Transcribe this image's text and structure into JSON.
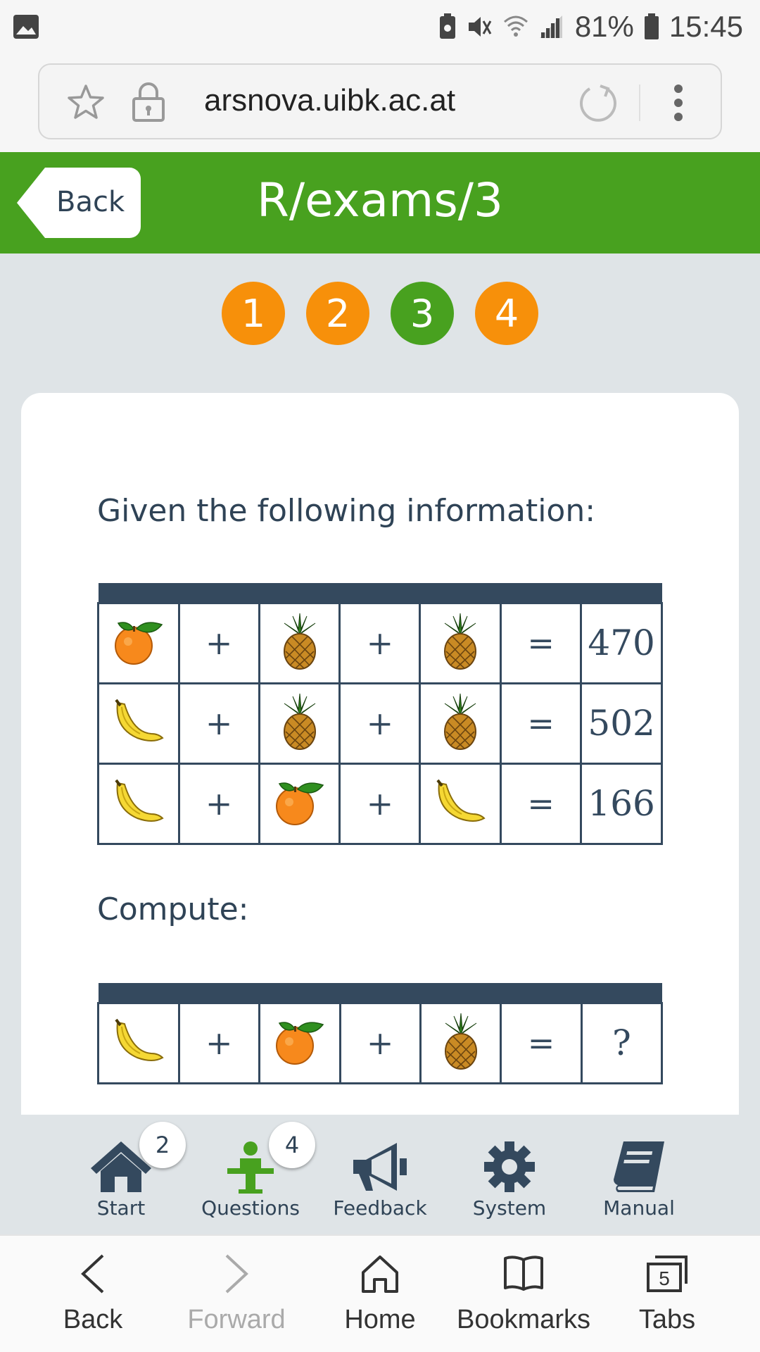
{
  "status_bar": {
    "battery_percent": "81%",
    "time": "15:45"
  },
  "browser": {
    "url": "arsnova.uibk.ac.at"
  },
  "header": {
    "back_label": "Back",
    "title": "R/exams/3"
  },
  "pager": [
    "1",
    "2",
    "3",
    "4"
  ],
  "question": {
    "intro": "Given the following information:",
    "rows": [
      {
        "items": [
          "orange",
          "+",
          "pineapple",
          "+",
          "pineapple",
          "="
        ],
        "result": "470"
      },
      {
        "items": [
          "banana",
          "+",
          "pineapple",
          "+",
          "pineapple",
          "="
        ],
        "result": "502"
      },
      {
        "items": [
          "banana",
          "+",
          "orange",
          "+",
          "banana",
          "="
        ],
        "result": "166"
      }
    ],
    "compute_label": "Compute:",
    "compute_row": {
      "items": [
        "banana",
        "+",
        "orange",
        "+",
        "pineapple",
        "="
      ],
      "result": "?"
    }
  },
  "app_nav": [
    {
      "label": "Start",
      "badge": "2"
    },
    {
      "label": "Questions",
      "badge": "4"
    },
    {
      "label": "Feedback"
    },
    {
      "label": "System"
    },
    {
      "label": "Manual"
    }
  ],
  "browser_nav": {
    "back": "Back",
    "forward": "Forward",
    "home": "Home",
    "bookmarks": "Bookmarks",
    "tabs": "Tabs",
    "tab_count": "5"
  },
  "colors": {
    "header_green": "#48a11f",
    "pager_orange": "#f7900a",
    "pager_active": "#48a11f",
    "table_dark": "#34495e",
    "text_dark": "#2f4356"
  }
}
